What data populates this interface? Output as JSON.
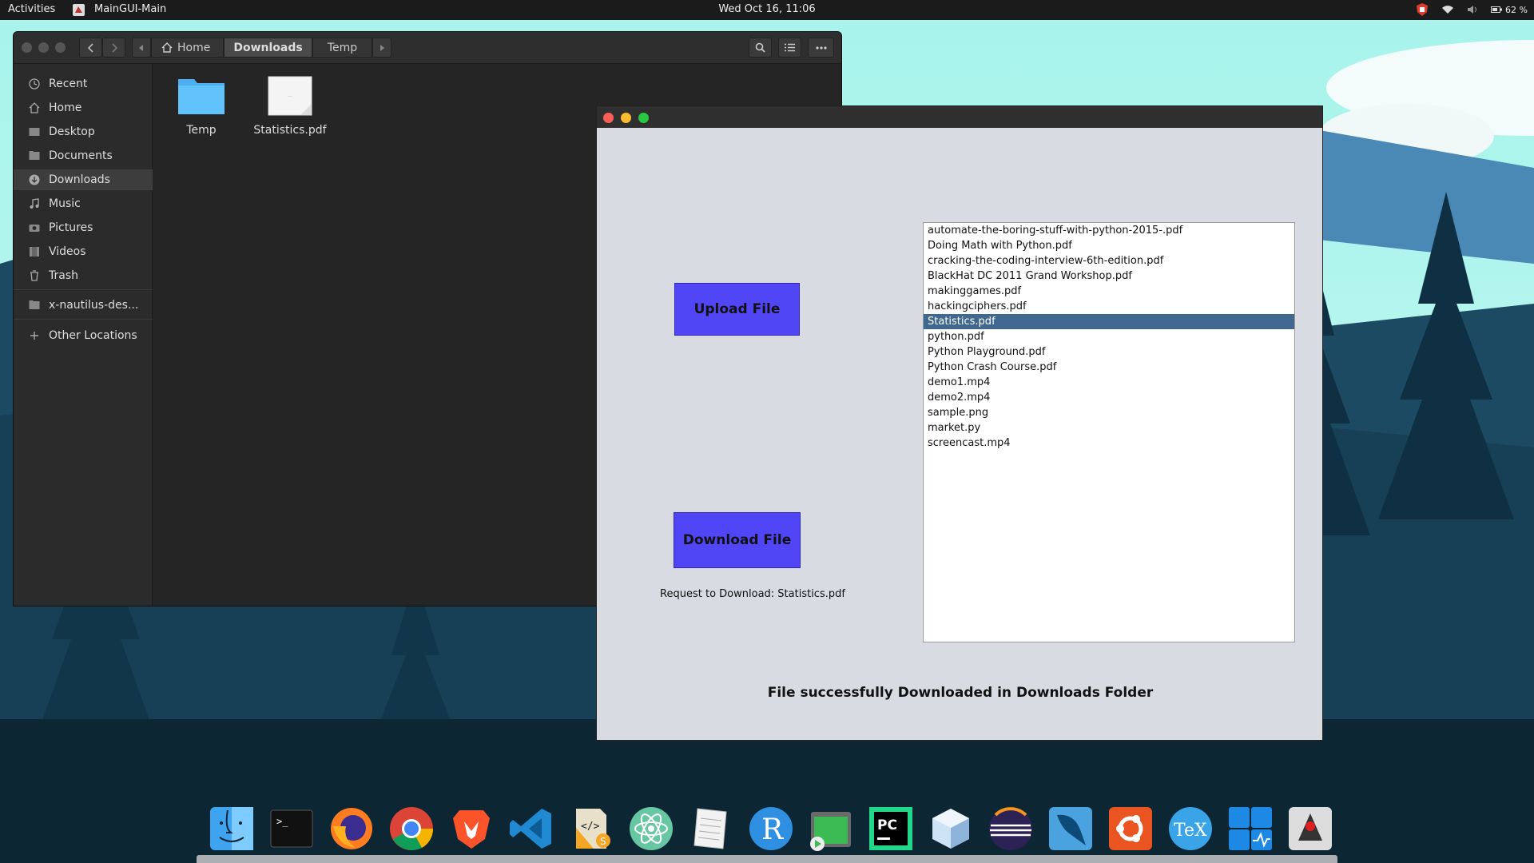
{
  "topbar": {
    "activities": "Activities",
    "app_name": "MainGUI-Main",
    "clock": "Wed Oct 16, 11:06",
    "battery": "62 %"
  },
  "file_manager": {
    "breadcrumbs": [
      "Home",
      "Downloads",
      "Temp"
    ],
    "sidebar": [
      {
        "label": "Recent",
        "icon": "clock-icon"
      },
      {
        "label": "Home",
        "icon": "home-icon"
      },
      {
        "label": "Desktop",
        "icon": "desktop-icon"
      },
      {
        "label": "Documents",
        "icon": "documents-icon"
      },
      {
        "label": "Downloads",
        "icon": "downloads-icon",
        "selected": true
      },
      {
        "label": "Music",
        "icon": "music-icon"
      },
      {
        "label": "Pictures",
        "icon": "camera-icon"
      },
      {
        "label": "Videos",
        "icon": "film-icon"
      },
      {
        "label": "Trash",
        "icon": "trash-icon"
      }
    ],
    "drive_label": "x-nautilus-des...",
    "other_locations": "Other Locations",
    "files": [
      {
        "name": "Temp",
        "type": "folder"
      },
      {
        "name": "Statistics.pdf",
        "type": "document"
      }
    ]
  },
  "app": {
    "upload_label": "Upload File",
    "download_label": "Download File",
    "request_text": "Request to Download: Statistics.pdf",
    "status_text": "File successfully Downloaded in Downloads Folder",
    "file_list": [
      "automate-the-boring-stuff-with-python-2015-.pdf",
      "Doing Math with Python.pdf",
      "cracking-the-coding-interview-6th-edition.pdf",
      "BlackHat DC 2011 Grand Workshop.pdf",
      "makinggames.pdf",
      "hackingciphers.pdf",
      "Statistics.pdf",
      "python.pdf",
      "Python Playground.pdf",
      "Python Crash Course.pdf",
      "demo1.mp4",
      "demo2.mp4",
      "sample.png",
      "market.py",
      "screencast.mp4"
    ],
    "selected_file": "Statistics.pdf",
    "colors": {
      "button": "#5146f5",
      "selection": "#40688f",
      "close": "#fc5f57",
      "minimize": "#fdbc2e",
      "maximize": "#28c840"
    }
  },
  "dock": [
    {
      "name": "finder-icon"
    },
    {
      "name": "terminal-icon",
      "text": ">_"
    },
    {
      "name": "firefox-icon"
    },
    {
      "name": "chrome-icon"
    },
    {
      "name": "brave-icon"
    },
    {
      "name": "vscode-icon"
    },
    {
      "name": "sublime-icon",
      "text": "</>"
    },
    {
      "name": "atom-icon"
    },
    {
      "name": "text-editor-icon"
    },
    {
      "name": "r-icon",
      "text": "R"
    },
    {
      "name": "sequel-icon"
    },
    {
      "name": "pycharm-icon",
      "text": "PC"
    },
    {
      "name": "virtualbox-icon"
    },
    {
      "name": "eclipse-icon"
    },
    {
      "name": "mysql-workbench-icon"
    },
    {
      "name": "ubuntu-icon"
    },
    {
      "name": "tex-icon",
      "text": "TeX"
    },
    {
      "name": "system-tools-icon"
    },
    {
      "name": "java-icon"
    }
  ]
}
